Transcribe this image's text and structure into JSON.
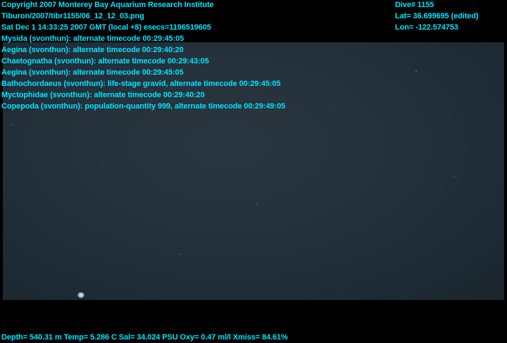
{
  "header": {
    "copyright": "Copyright 2007 Monterey Bay Aquarium Research Institute",
    "image_path": "Tiburon/2007/tibr1155/06_12_12_03.png",
    "datetime": "Sat Dec  1 14:33:25 2007 GMT (local +8)  esecs=1196519605"
  },
  "dive_info": {
    "dive": "Dive# 1155",
    "lat": "Lat= 36.699695 (edited)",
    "lon": "Lon= -122.574753"
  },
  "annotations": [
    "Mysida (svonthun): alternate timecode 00:29:45:05",
    "Aegina (svonthun): alternate timecode 00:29:40:20",
    "Chaetognatha (svonthun): alternate timecode 00:29:43:05",
    "Aegina (svonthun): alternate timecode 00:29:45:05",
    "Bathochordaeus (svonthun): life-stage gravid, alternate timecode 00:29:45:05",
    "Myctophidae (svonthun): alternate timecode 00:29:40:20",
    "Copepoda (svonthun): population-quantity 999, alternate timecode 00:29:49:05"
  ],
  "sensors": {
    "readout": "Depth= 540.31 m  Temp= 5.286 C  Sal= 34.024 PSU  Oxy= 0.47 ml/l  Xmiss= 84.61%"
  },
  "colors": {
    "overlay_text": "#00e5ff",
    "water": "#24303a",
    "border": "#000000"
  }
}
